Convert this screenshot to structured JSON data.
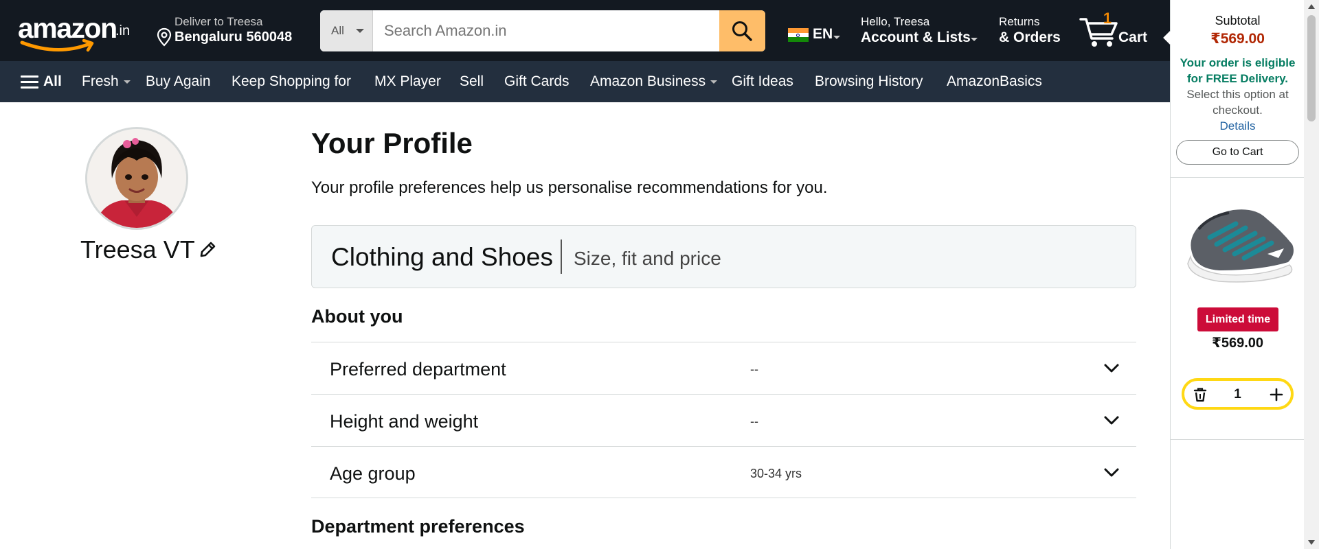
{
  "header": {
    "logo_text": "amazon",
    "logo_suffix": ".in",
    "deliver_line1": "Deliver to Treesa",
    "deliver_line2": "Bengaluru 560048",
    "search_category": "All",
    "search_placeholder": "Search Amazon.in",
    "language": "EN",
    "account_line1": "Hello, Treesa",
    "account_line2": "Account & Lists",
    "orders_line1": "Returns",
    "orders_line2": "& Orders",
    "cart_count": "1",
    "cart_label": "Cart"
  },
  "subnav": {
    "all_label": "All",
    "items": [
      "Fresh",
      "Buy Again",
      "Keep Shopping for",
      "MX Player",
      "Sell",
      "Gift Cards",
      "Amazon Business",
      "Gift Ideas",
      "Browsing History",
      "AmazonBasics"
    ]
  },
  "profile": {
    "name": "Treesa VT",
    "title": "Your Profile",
    "subtitle": "Your profile preferences help us personalise recommendations for you.",
    "tab_title": "Clothing and Shoes",
    "tab_subtitle": "Size, fit and price",
    "about_heading": "About you",
    "rows": [
      {
        "label": "Preferred department",
        "value": "--"
      },
      {
        "label": "Height and weight",
        "value": "--"
      },
      {
        "label": "Age group",
        "value": "30-34 yrs"
      }
    ],
    "dept_heading": "Department preferences"
  },
  "cart_panel": {
    "subtotal_label": "Subtotal",
    "subtotal_value": "₹569.00",
    "free_delivery_bold": "Your order is eligible for FREE Delivery.",
    "free_delivery_rest": " Select this option at checkout.",
    "details_link": "Details",
    "go_to_cart": "Go to Cart",
    "badge": "Limited time",
    "item_price": "₹569.00",
    "quantity": "1"
  },
  "colors": {
    "nav_bg": "#131921",
    "subnav_bg": "#232f3e",
    "search_button": "#febd69",
    "price_red": "#b12704",
    "free_green": "#067d62",
    "badge_red": "#cc0c39",
    "qty_border": "#ffd814",
    "link_blue": "#2162a1"
  },
  "icons": [
    "location-pin-icon",
    "search-icon",
    "india-flag-icon",
    "cart-icon",
    "hamburger-menu-icon",
    "edit-pencil-icon",
    "chevron-down-icon",
    "trash-icon",
    "plus-icon"
  ]
}
